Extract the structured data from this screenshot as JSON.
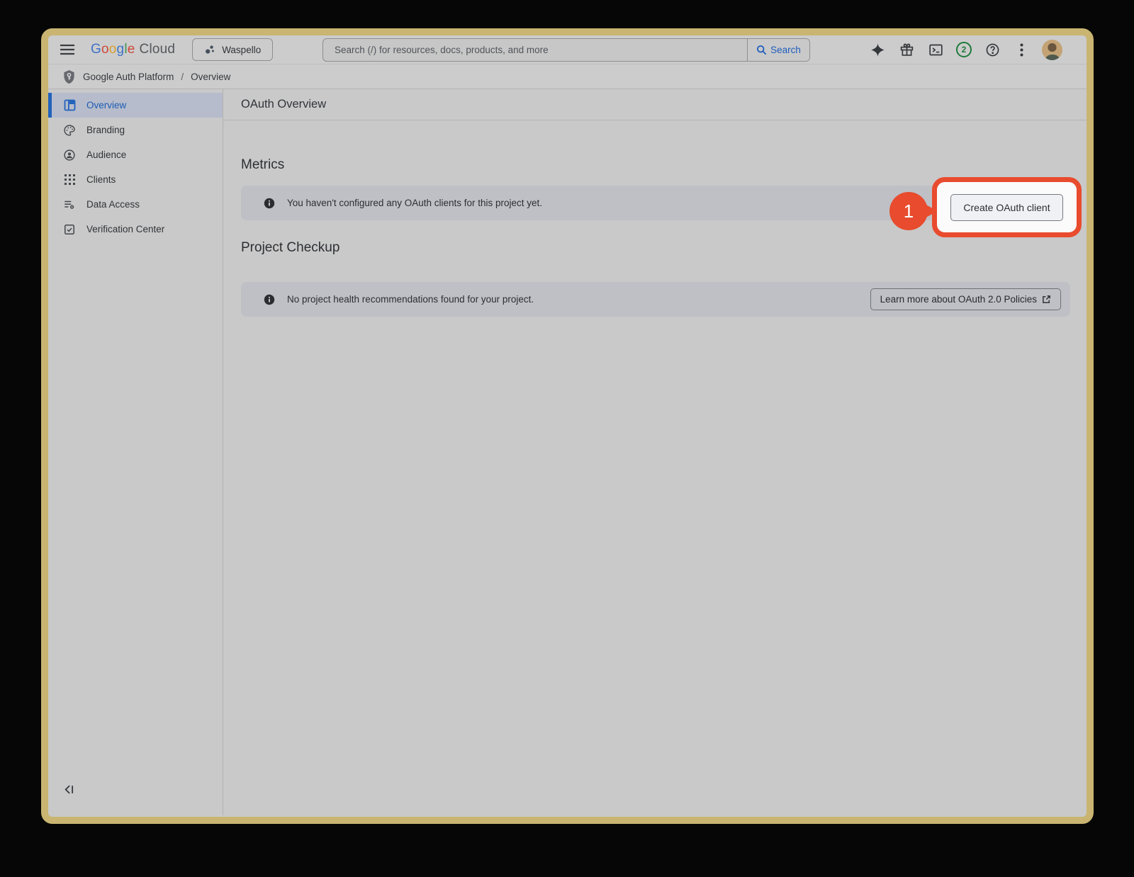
{
  "window": {
    "topbar": {
      "logo_google": "Google",
      "logo_cloud": "Cloud",
      "project_selector": "Waspello",
      "search_placeholder": "Search (/) for resources, docs, products, and more",
      "search_button": "Search",
      "notification_count": "2"
    },
    "breadcrumb": {
      "section": "Google Auth Platform",
      "separator": "/",
      "page": "Overview"
    },
    "sidebar": {
      "items": [
        {
          "label": "Overview",
          "active": true
        },
        {
          "label": "Branding",
          "active": false
        },
        {
          "label": "Audience",
          "active": false
        },
        {
          "label": "Clients",
          "active": false
        },
        {
          "label": "Data Access",
          "active": false
        },
        {
          "label": "Verification Center",
          "active": false
        }
      ]
    },
    "main": {
      "page_title": "OAuth Overview",
      "metrics": {
        "heading": "Metrics",
        "info_text": "You haven't configured any OAuth clients for this project yet.",
        "create_button": "Create OAuth client"
      },
      "checkup": {
        "heading": "Project Checkup",
        "info_text": "No project health recommendations found for your project.",
        "learn_more_button": "Learn more about OAuth 2.0 Policies"
      }
    },
    "annotation": {
      "step_number": "1"
    },
    "colors": {
      "annotation_orange": "#e84b2d",
      "frame_tan": "#c9b571",
      "active_blue": "#2262bc",
      "badge_green": "#1f7a3c",
      "info_bar_gray": "#bec0c5"
    }
  }
}
